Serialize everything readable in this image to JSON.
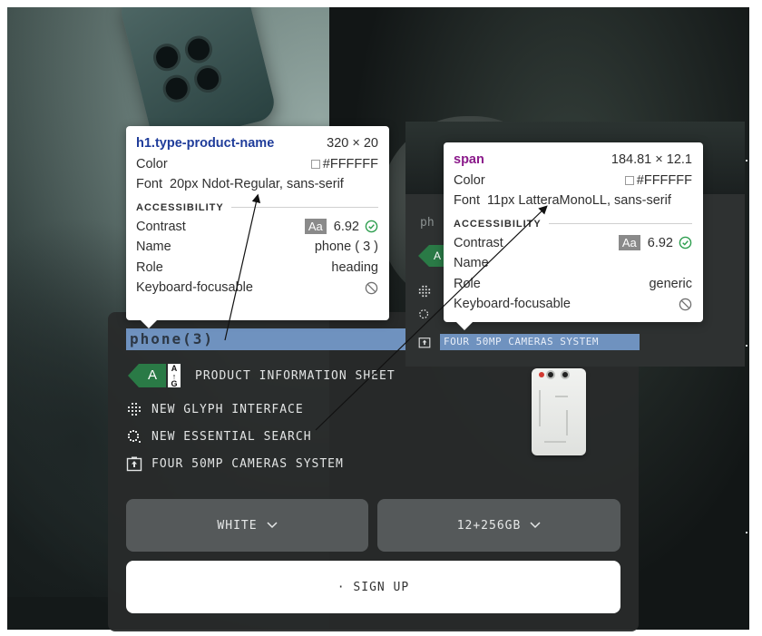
{
  "product_panel": {
    "title": "phone(3)",
    "energy_badge_letter": "A",
    "energy_badge_scale": "A↑G",
    "info_sheet_label": "PRODUCT INFORMATION SHEET",
    "features": [
      {
        "icon": "glyph-grid-icon",
        "label": "NEW GLYPH INTERFACE"
      },
      {
        "icon": "essential-search-icon",
        "label": "NEW ESSENTIAL SEARCH"
      },
      {
        "icon": "camera-upload-icon",
        "label": "FOUR 50MP CAMERAS SYSTEM"
      }
    ],
    "color_select": {
      "value": "WHITE",
      "icon": "chevron-down-icon"
    },
    "storage_select": {
      "value": "12+256GB",
      "icon": "chevron-down-icon"
    },
    "signup_label": "· SIGN UP",
    "highlight_color": "#6f92bf",
    "panel_color": "#282a2b"
  },
  "inspect_tooltip_heading": {
    "tag": "h1",
    "class_name": ".type-product-name",
    "dimensions": "320 × 20",
    "color_label": "Color",
    "color_value": "#FFFFFF",
    "font_label": "Font",
    "font_value": "20px Ndot-Regular, sans-serif",
    "section_title": "ACCESSIBILITY",
    "contrast_label": "Contrast",
    "contrast_badge": "Aa",
    "contrast_value": "6.92",
    "name_label": "Name",
    "name_value": "phone ( 3 )",
    "role_label": "Role",
    "role_value": "heading",
    "focusable_label": "Keyboard-focusable"
  },
  "inspect_tooltip_span": {
    "tag": "span",
    "dimensions": "184.81 × 12.1",
    "color_label": "Color",
    "color_value": "#FFFFFF",
    "font_label": "Font",
    "font_value": "11px LatteraMonoLL, sans-serif",
    "section_title": "ACCESSIBILITY",
    "contrast_label": "Contrast",
    "contrast_badge": "Aa",
    "contrast_value": "6.92",
    "name_label": "Name",
    "role_label": "Role",
    "role_value": "generic",
    "focusable_label": "Keyboard-focusable",
    "highlighted_text": "FOUR 50MP CAMERAS SYSTEM",
    "background_title_fragment": "ph"
  },
  "colors": {
    "contrast_pass": "#2e9e4f",
    "selector_tag": "#8b1b8b",
    "selector_class": "#1f3c9a",
    "energy_green": "#2a7a46"
  }
}
